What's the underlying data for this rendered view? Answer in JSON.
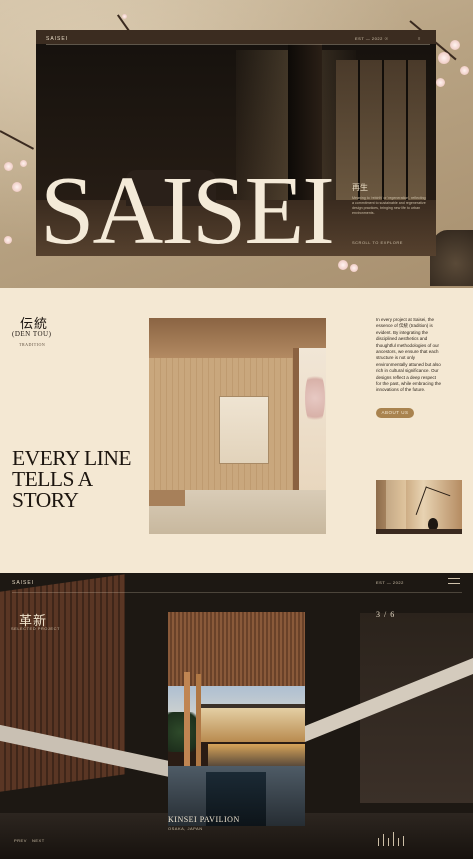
{
  "hero": {
    "brand": "SAISEI",
    "est": "EST — 2022 ☉",
    "menu": "≡",
    "title": "SAISEI",
    "kanji": "再生",
    "description": "Meaning to 'rebirth' or 'regeneration', reflecting a commitment to sustainable and regenerative design practices, bringing new life to urban environments.",
    "scroll": "SCROLL TO EXPLORE"
  },
  "tradition": {
    "kanji": "伝統",
    "roman": "(DEN TOU)",
    "translation": "TRADITION",
    "headline": "EVERY LINE TELLS A STORY",
    "body": "In every project at Saisei, the essence of 伝統 (tradition) is evident. By integrating the disciplined aesthetics and thoughtful methodologies of our ancestors, we ensure that each structure is not only environmentally attuned but also rich in cultural significance. Our designs reflect a deep respect for the past, while embracing the innovations of the future.",
    "button": "ABOUT US"
  },
  "projects": {
    "brand": "SAISEI",
    "est": "EST — 2022",
    "kanji": "革新",
    "selected": "SELECTED PROJECT",
    "counter": "3 / 6",
    "project_name": "KINSEI PAVILION",
    "location": "OSAKA, JAPAN",
    "prev": "PREV",
    "next": "NEXT"
  },
  "icons": [
    "menu-icon",
    "progress-bars-icon"
  ]
}
